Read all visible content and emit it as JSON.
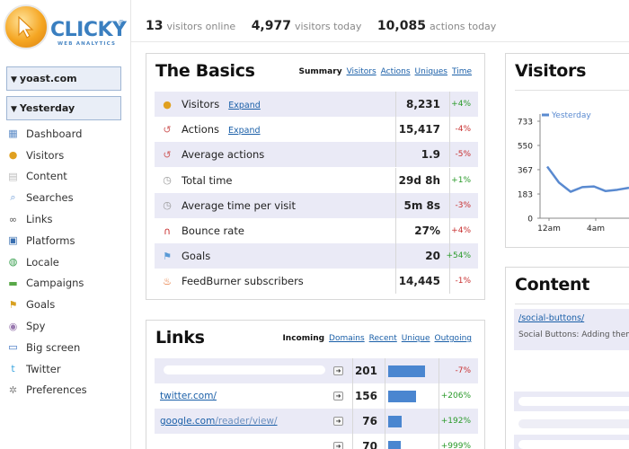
{
  "brand": {
    "name": "CLICKY",
    "registered": "®",
    "subtitle": "WEB ANALYTICS"
  },
  "site_selector": {
    "value": "yoast.com"
  },
  "date_selector": {
    "value": "Yesterday"
  },
  "nav": [
    {
      "label": "Dashboard",
      "icon": "dashboard-icon",
      "color": "#5a8ac6"
    },
    {
      "label": "Visitors",
      "icon": "visitors-icon",
      "color": "#e0a020"
    },
    {
      "label": "Content",
      "icon": "content-icon",
      "color": "#bbbbbb"
    },
    {
      "label": "Searches",
      "icon": "search-icon",
      "color": "#6a9ad6"
    },
    {
      "label": "Links",
      "icon": "link-icon",
      "color": "#555555"
    },
    {
      "label": "Platforms",
      "icon": "monitor-icon",
      "color": "#3a6fb0"
    },
    {
      "label": "Locale",
      "icon": "globe-icon",
      "color": "#3aa050"
    },
    {
      "label": "Campaigns",
      "icon": "money-icon",
      "color": "#58a848"
    },
    {
      "label": "Goals",
      "icon": "flag-icon",
      "color": "#d8a020"
    },
    {
      "label": "Spy",
      "icon": "eye-icon",
      "color": "#9a7ab0"
    },
    {
      "label": "Big screen",
      "icon": "tv-icon",
      "color": "#3a70c0"
    },
    {
      "label": "Twitter",
      "icon": "twitter-icon",
      "color": "#40a8e0"
    },
    {
      "label": "Preferences",
      "icon": "gear-icon",
      "color": "#888888"
    }
  ],
  "summary": {
    "online_count": "13",
    "online_label": "visitors online",
    "today_count": "4,977",
    "today_label": "visitors today",
    "actions_count": "10,085",
    "actions_label": "actions today"
  },
  "basics": {
    "title": "The Basics",
    "tabs": [
      {
        "label": "Summary",
        "active": true
      },
      {
        "label": "Visitors",
        "active": false
      },
      {
        "label": "Actions",
        "active": false
      },
      {
        "label": "Uniques",
        "active": false
      },
      {
        "label": "Time",
        "active": false
      }
    ],
    "rows": [
      {
        "label": "Visitors",
        "expand": "Expand",
        "value": "8,231",
        "change": "+4%",
        "dir": "pos",
        "icon": "visitors-icon"
      },
      {
        "label": "Actions",
        "expand": "Expand",
        "value": "15,417",
        "change": "-4%",
        "dir": "neg",
        "icon": "actions-icon"
      },
      {
        "label": "Average actions",
        "expand": "",
        "value": "1.9",
        "change": "-5%",
        "dir": "neg",
        "icon": "actions-icon"
      },
      {
        "label": "Total time",
        "expand": "",
        "value": "29d 8h",
        "change": "+1%",
        "dir": "pos",
        "icon": "clock-icon"
      },
      {
        "label": "Average time per visit",
        "expand": "",
        "value": "5m 8s",
        "change": "-3%",
        "dir": "neg",
        "icon": "clock-icon"
      },
      {
        "label": "Bounce rate",
        "expand": "",
        "value": "27%",
        "change": "+4%",
        "dir": "neg",
        "icon": "magnet-icon"
      },
      {
        "label": "Goals",
        "expand": "",
        "value": "20",
        "change": "+54%",
        "dir": "pos",
        "icon": "flag-icon"
      },
      {
        "label": "FeedBurner subscribers",
        "expand": "",
        "value": "14,445",
        "change": "-1%",
        "dir": "neg",
        "icon": "feedburner-icon"
      }
    ]
  },
  "links": {
    "title": "Links",
    "tabs": [
      {
        "label": "Incoming",
        "active": true
      },
      {
        "label": "Domains",
        "active": false
      },
      {
        "label": "Recent",
        "active": false
      },
      {
        "label": "Unique",
        "active": false
      },
      {
        "label": "Outgoing",
        "active": false
      }
    ],
    "rows": [
      {
        "domain": "",
        "path": "",
        "count": "201",
        "bar": 0.75,
        "change": "-7%",
        "dir": "neg"
      },
      {
        "domain": "twitter.com/",
        "path": "",
        "count": "156",
        "bar": 0.58,
        "change": "+206%",
        "dir": "pos"
      },
      {
        "domain": "google.com",
        "path": "/reader/view/",
        "count": "76",
        "bar": 0.28,
        "change": "+192%",
        "dir": "pos"
      },
      {
        "domain": "",
        "path": "",
        "count": "70",
        "bar": 0.26,
        "change": "+999%",
        "dir": "pos"
      }
    ]
  },
  "visitors_panel": {
    "title": "Visitors",
    "legend": "Yesterday",
    "yticks": [
      "733",
      "550",
      "367",
      "183",
      "0"
    ],
    "xticks": [
      "12am",
      "4am"
    ]
  },
  "chart_data": {
    "type": "line",
    "series": [
      {
        "name": "Yesterday",
        "values": [
          390,
          270,
          200,
          235,
          240,
          205,
          215,
          230
        ]
      }
    ],
    "ylim": [
      0,
      733
    ],
    "y_ticks": [
      0,
      183,
      367,
      550,
      733
    ],
    "x_tick_labels": [
      "12am",
      "4am"
    ],
    "color": "#5a8ad0"
  },
  "content_panel": {
    "title": "Content",
    "link": "/social-buttons/",
    "desc": "Social Buttons: Adding them t"
  }
}
